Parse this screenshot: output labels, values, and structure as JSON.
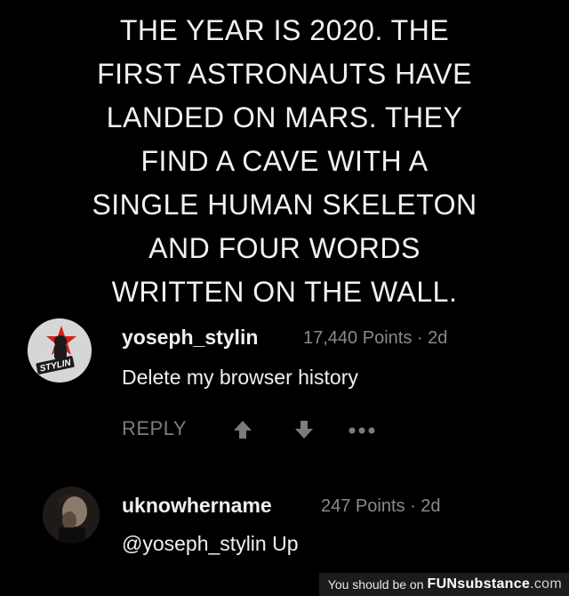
{
  "headline": {
    "lines": [
      "THE YEAR IS 2020. THE",
      "FIRST ASTRONAUTS HAVE",
      "LANDED ON MARS. THEY",
      "FIND A CAVE WITH A",
      "SINGLE HUMAN SKELETON",
      "AND FOUR WORDS",
      "WRITTEN ON THE WALL."
    ]
  },
  "comments": [
    {
      "username": "yoseph_stylin",
      "points": "17,440 Points · 2d",
      "text": "Delete my browser history",
      "avatar_label": "STYLIN",
      "actions": {
        "reply_label": "REPLY",
        "upvote_icon": "arrow-up-icon",
        "downvote_icon": "arrow-down-icon",
        "more_icon": "ellipsis-icon"
      }
    },
    {
      "username": "uknowhername",
      "points": "247 Points · 2d",
      "text": "@yoseph_stylin Up"
    }
  ],
  "watermark": {
    "prefix": "You should be on",
    "brand_strong": "FUNsubstance",
    "brand_light": ".com"
  },
  "colors": {
    "background": "#000000",
    "text": "#f0f0f0",
    "muted": "#8a8a8a",
    "avatar_star": "#d32020"
  }
}
